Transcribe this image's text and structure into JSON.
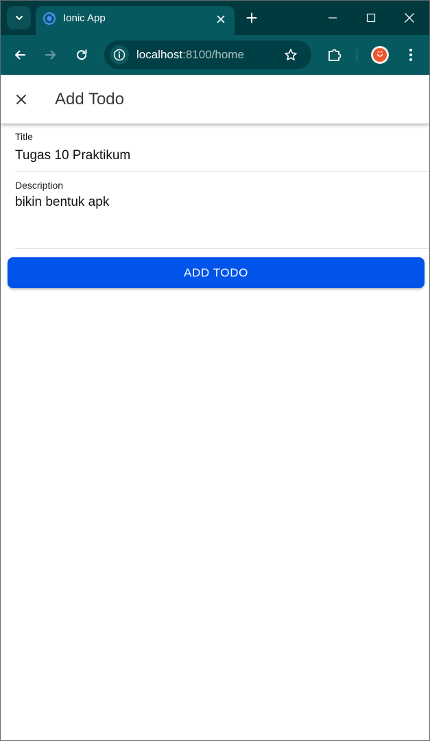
{
  "browser": {
    "tab": {
      "title": "Ionic App"
    },
    "address_bar": {
      "host": "localhost",
      "path": ":8100/home"
    },
    "icons": {
      "tab_search": "chevron-down-icon",
      "favicon": "ionic-logo-icon",
      "tab_close": "close-icon",
      "new_tab": "plus-icon",
      "minimize": "minimize-icon",
      "maximize": "maximize-icon",
      "close_window": "close-icon",
      "back": "arrow-left-icon",
      "forward": "arrow-right-icon",
      "reload": "reload-icon",
      "site_info": "info-icon",
      "bookmark": "star-icon",
      "extensions": "puzzle-icon",
      "profile": "avatar",
      "menu": "more-vertical-icon"
    },
    "colors": {
      "frame": "#003a3f",
      "toolbar": "#075960",
      "omnibox": "#003f45"
    }
  },
  "page": {
    "header": {
      "title": "Add Todo",
      "close_icon": "close-icon"
    },
    "form": {
      "title_field": {
        "label": "Title",
        "value": "Tugas 10 Praktikum"
      },
      "description_field": {
        "label": "Description",
        "value": "bikin bentuk apk"
      }
    },
    "add_button": {
      "label": "ADD TODO",
      "color": "#0054e9"
    }
  }
}
